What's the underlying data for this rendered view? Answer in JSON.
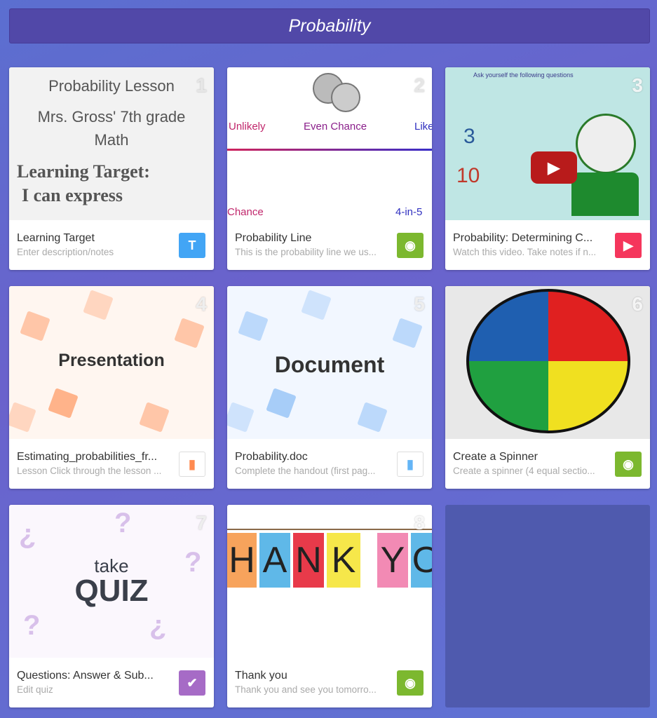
{
  "header": {
    "title": "Probability"
  },
  "cards": [
    {
      "number": "1",
      "title": "Learning Target",
      "description": "Enter description/notes",
      "type_icon": "text-icon",
      "badge_label": "T",
      "badge_color": "#42a5f5",
      "thumb": {
        "line1": "Probability Lesson",
        "line2": "Mrs. Gross' 7th grade",
        "line3": "Math",
        "line4": "Learning Target:",
        "line5": "I can express"
      }
    },
    {
      "number": "2",
      "title": "Probability Line",
      "description": "This is the probability line we us...",
      "type_icon": "camera-icon",
      "badge_color": "#7cb82f",
      "thumb": {
        "unlikely": "Unlikely",
        "even": "Even Chance",
        "likely": "Like",
        "chance": "Chance",
        "four": "4-in-5"
      }
    },
    {
      "number": "3",
      "title": "Probability: Determining C...",
      "description": "Watch this video. Take notes if n...",
      "type_icon": "play-icon",
      "badge_color": "#f5365c",
      "thumb": {
        "q": "Ask yourself the following questions",
        "num": "3",
        "den": "10"
      }
    },
    {
      "number": "4",
      "title": "Estimating_probabilities_fr...",
      "description": "Lesson Click through the lesson ...",
      "type_icon": "file-icon",
      "badge_color": "#ff8a50",
      "thumb": {
        "label": "Presentation"
      }
    },
    {
      "number": "5",
      "title": "Probability.doc",
      "description": "Complete the handout (first pag...",
      "type_icon": "file-icon",
      "badge_color": "#64b5f6",
      "thumb": {
        "label": "Document"
      }
    },
    {
      "number": "6",
      "title": "Create a Spinner",
      "description": "Create a spinner (4 equal sectio...",
      "type_icon": "camera-icon",
      "badge_color": "#7cb82f"
    },
    {
      "number": "7",
      "title": "Questions: Answer & Sub...",
      "description": "Edit quiz",
      "type_icon": "check-icon",
      "badge_color": "#a66bc6",
      "thumb": {
        "take": "take",
        "quiz": "QUIZ"
      }
    },
    {
      "number": "8",
      "title": "Thank you",
      "description": "Thank you and see you tomorro...",
      "type_icon": "camera-icon",
      "badge_color": "#7cb82f",
      "thumb": {
        "letters": [
          "H",
          "A",
          "N",
          "K",
          "Y",
          "O"
        ]
      }
    }
  ]
}
